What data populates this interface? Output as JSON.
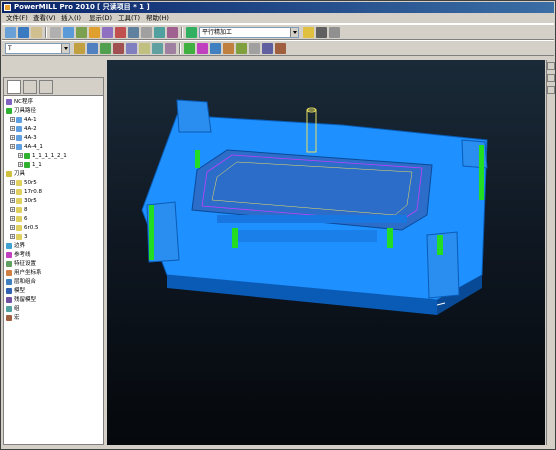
{
  "window": {
    "title": "PowerMILL Pro 2010",
    "document": "[ 只读项目 * 1 ]"
  },
  "menu": [
    "文件(F)",
    "查看(V)",
    "插入(I)",
    "显示(D)",
    "工具(T)",
    "帮助(H)"
  ],
  "toolbar": {
    "strategy_combo": "平行精加工",
    "tool_combo": "T",
    "empty_combo_1": "",
    "empty_combo_2": ""
  },
  "explorer": {
    "rows": [
      {
        "label": "NC程序",
        "icon": "nc-program-icon"
      },
      {
        "label": "刀具路径",
        "icon": "toolpath-folder-icon"
      },
      {
        "label": "4A-1",
        "icon": "toolpath-icon"
      },
      {
        "label": "4A-2",
        "icon": "toolpath-icon"
      },
      {
        "label": "4A-3",
        "icon": "toolpath-icon"
      },
      {
        "label": "4A-4_1",
        "icon": "toolpath-icon"
      },
      {
        "label": "1_1_1_1_2_1",
        "icon": "toolpath-icon"
      },
      {
        "label": "1_1",
        "icon": "toolpath-icon"
      },
      {
        "label": "刀具",
        "icon": "tool-folder-icon"
      },
      {
        "label": "50r5",
        "icon": "tool-icon"
      },
      {
        "label": "17r0.8",
        "icon": "tool-icon"
      },
      {
        "label": "30r5",
        "icon": "tool-icon"
      },
      {
        "label": "8",
        "icon": "tool-icon"
      },
      {
        "label": "6",
        "icon": "tool-icon"
      },
      {
        "label": "6r0.5",
        "icon": "tool-icon"
      },
      {
        "label": "3",
        "icon": "tool-icon"
      },
      {
        "label": "边界",
        "icon": "boundary-icon"
      },
      {
        "label": "参考线",
        "icon": "pattern-icon"
      },
      {
        "label": "特征设置",
        "icon": "feature-icon"
      },
      {
        "label": "用户坐标系",
        "icon": "workplane-icon"
      },
      {
        "label": "层和组合",
        "icon": "layer-icon"
      },
      {
        "label": "模型",
        "icon": "model-icon"
      },
      {
        "label": "残留模型",
        "icon": "stock-model-icon"
      },
      {
        "label": "组",
        "icon": "group-icon"
      },
      {
        "label": "宏",
        "icon": "macro-icon"
      }
    ]
  },
  "colors": {
    "part_blue": "#1e90ff",
    "part_dark": "#0a5bb5",
    "accent_green": "#22dd22",
    "toolpath_magenta": "#c040ff",
    "tool_yellow": "#e8e060"
  }
}
